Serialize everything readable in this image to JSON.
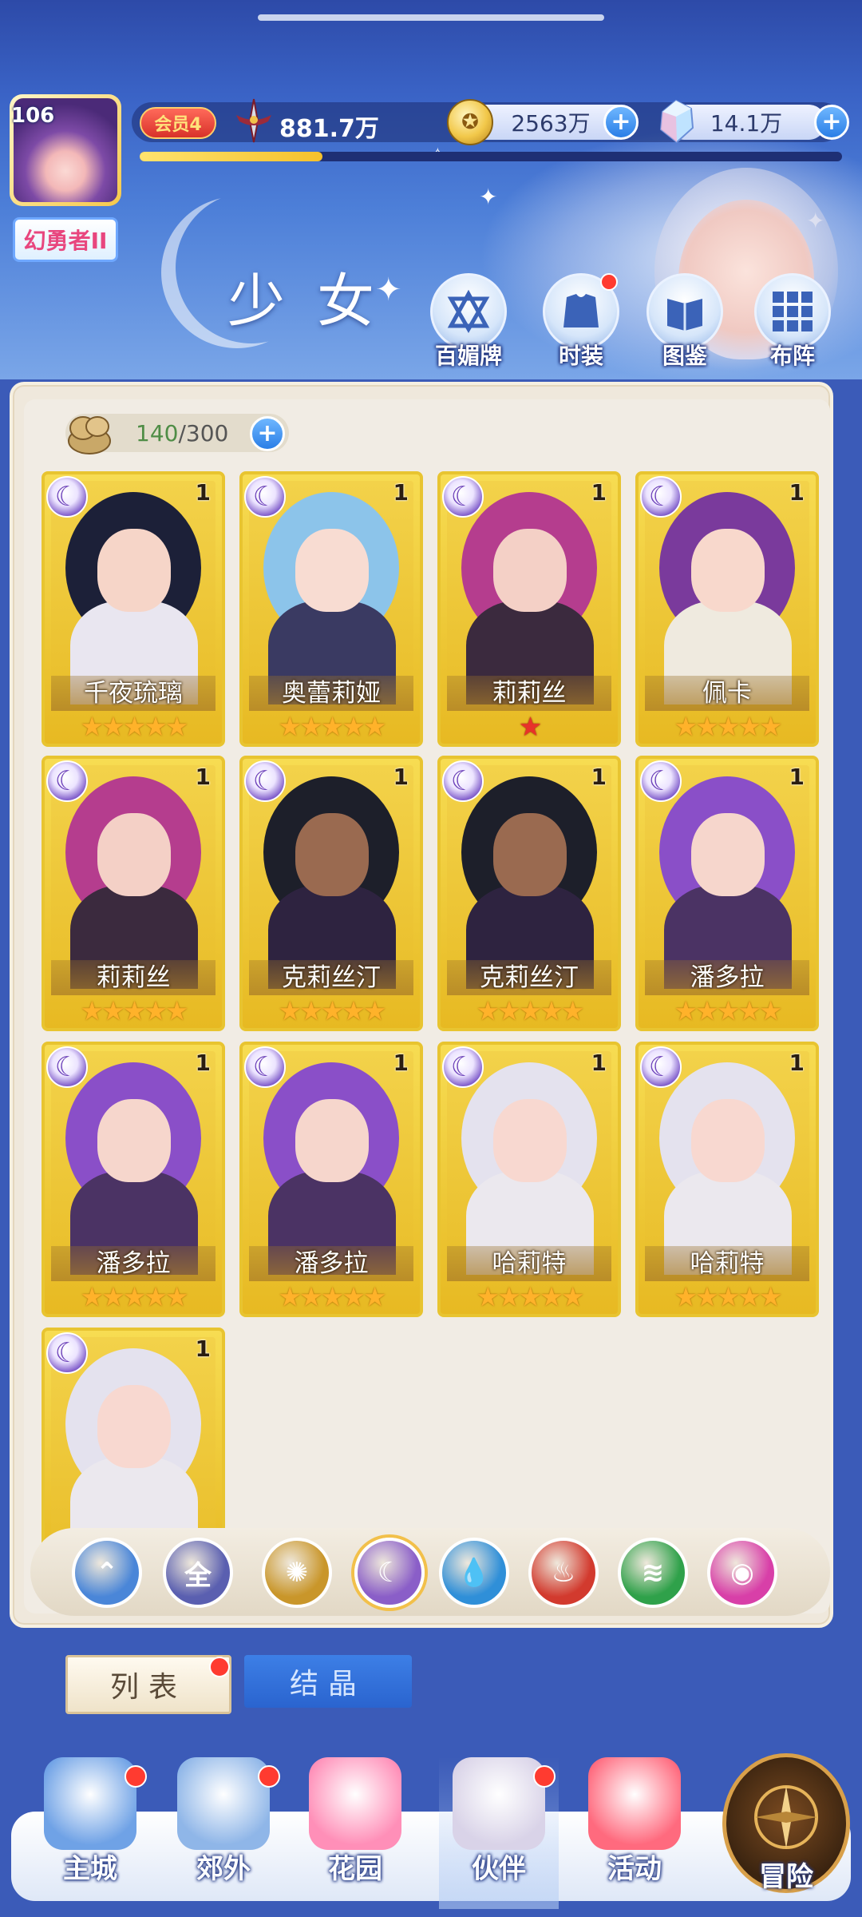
{
  "player": {
    "level": "106",
    "title_badge": "幻勇者II",
    "vip_label": "会员4",
    "power": "881.7万",
    "exp_progress": 0.26
  },
  "currencies": {
    "gold": "2563万",
    "gems": "14.1万"
  },
  "page_title": "少女",
  "features": [
    {
      "label": "百媚牌",
      "icon": "scroll-badge-icon",
      "badge": false
    },
    {
      "label": "时装",
      "icon": "outfit-icon",
      "badge": true
    },
    {
      "label": "图鉴",
      "icon": "book-icon",
      "badge": false
    },
    {
      "label": "布阵",
      "icon": "grid-formation-icon",
      "badge": false
    }
  ],
  "inventory": {
    "current": "140",
    "separator": "/",
    "max": "300"
  },
  "cards": [
    {
      "name": "千夜琉璃",
      "count": "1",
      "stars": 5,
      "star_color": "gold",
      "element": "moon-icon"
    },
    {
      "name": "奥蕾莉娅",
      "count": "1",
      "stars": 5,
      "star_color": "gold",
      "element": "moon-icon"
    },
    {
      "name": "莉莉丝",
      "count": "1",
      "stars": 1,
      "star_color": "red",
      "element": "moon-icon"
    },
    {
      "name": "佩卡",
      "count": "1",
      "stars": 5,
      "star_color": "gold",
      "element": "moon-icon"
    },
    {
      "name": "莉莉丝",
      "count": "1",
      "stars": 5,
      "star_color": "gold",
      "element": "moon-icon"
    },
    {
      "name": "克莉丝汀",
      "count": "1",
      "stars": 5,
      "star_color": "gold",
      "element": "moon-icon"
    },
    {
      "name": "克莉丝汀",
      "count": "1",
      "stars": 5,
      "star_color": "gold",
      "element": "moon-icon"
    },
    {
      "name": "潘多拉",
      "count": "1",
      "stars": 5,
      "star_color": "gold",
      "element": "moon-icon"
    },
    {
      "name": "潘多拉",
      "count": "1",
      "stars": 5,
      "star_color": "gold",
      "element": "moon-icon"
    },
    {
      "name": "潘多拉",
      "count": "1",
      "stars": 5,
      "star_color": "gold",
      "element": "moon-icon"
    },
    {
      "name": "哈莉特",
      "count": "1",
      "stars": 5,
      "star_color": "gold",
      "element": "moon-icon"
    },
    {
      "name": "哈莉特",
      "count": "1",
      "stars": 5,
      "star_color": "gold",
      "element": "moon-icon"
    },
    {
      "name": "",
      "count": "1",
      "stars": 0,
      "star_color": "gold",
      "element": "moon-icon"
    }
  ],
  "element_filters": [
    {
      "icon": "wind-icon",
      "label": "",
      "color": "#4a86d8"
    },
    {
      "icon": "all-icon",
      "label": "全",
      "color": "#5a5fb0"
    },
    {
      "icon": "sun-icon",
      "label": "",
      "color": "#c9962a"
    },
    {
      "icon": "moon-icon",
      "label": "",
      "color": "#8a5ec8",
      "selected": true
    },
    {
      "icon": "water-icon",
      "label": "",
      "color": "#2f8fd8"
    },
    {
      "icon": "fire-icon",
      "label": "",
      "color": "#d23a2e"
    },
    {
      "icon": "tornado-icon",
      "label": "",
      "color": "#2fa14a"
    },
    {
      "icon": "orb-icon",
      "label": "",
      "color": "#d83fa8"
    }
  ],
  "tabs": {
    "list": "列表",
    "crystal": "结晶"
  },
  "nav": [
    {
      "label": "主城",
      "icon": "castle-icon",
      "badge": true
    },
    {
      "label": "郊外",
      "icon": "portal-icon",
      "badge": true
    },
    {
      "label": "花园",
      "icon": "heart-icon",
      "badge": false
    },
    {
      "label": "伙伴",
      "icon": "partner-portrait-icon",
      "badge": true
    },
    {
      "label": "活动",
      "icon": "gift-icon",
      "badge": false
    },
    {
      "label": "冒险",
      "icon": "compass-icon",
      "badge": false
    }
  ]
}
